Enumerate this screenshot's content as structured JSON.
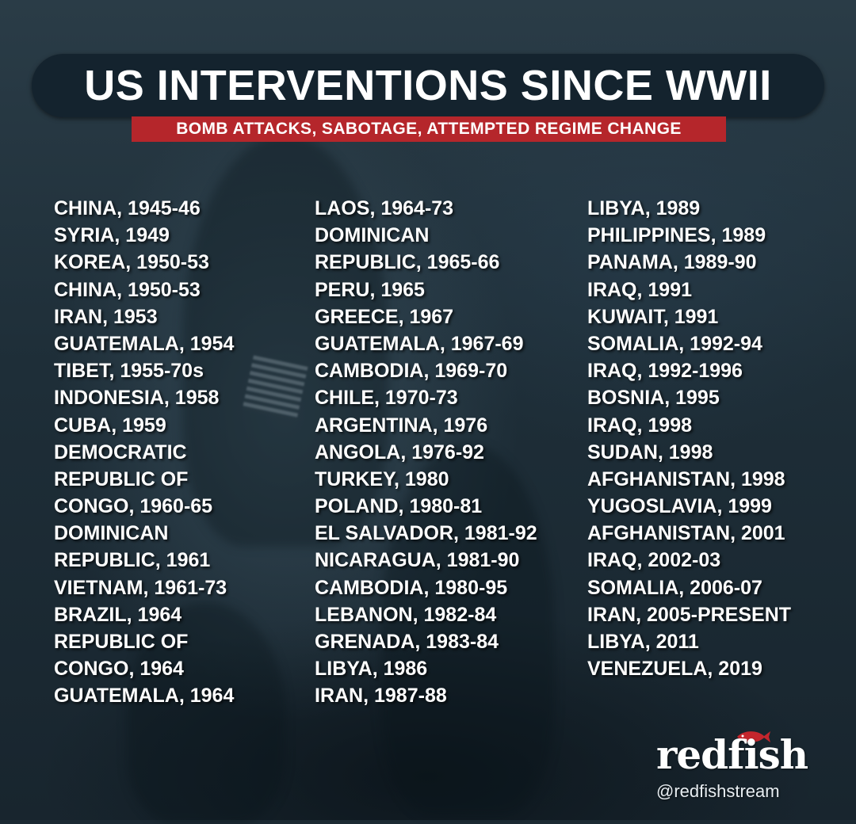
{
  "title": "US INTERVENTIONS SINCE WWII",
  "subtitle": "BOMB ATTACKS, SABOTAGE, ATTEMPTED REGIME CHANGE",
  "columns": [
    [
      "CHINA, 1945-46",
      "SYRIA, 1949",
      "KOREA, 1950-53",
      "CHINA, 1950-53",
      "IRAN, 1953",
      "GUATEMALA, 1954",
      "TIBET, 1955-70s",
      "INDONESIA, 1958",
      "CUBA, 1959",
      "DEMOCRATIC",
      "REPUBLIC OF",
      "CONGO, 1960-65",
      "DOMINICAN",
      "REPUBLIC, 1961",
      "VIETNAM, 1961-73",
      "BRAZIL, 1964",
      "REPUBLIC OF",
      "CONGO, 1964",
      "GUATEMALA, 1964"
    ],
    [
      "LAOS, 1964-73",
      "DOMINICAN",
      "REPUBLIC, 1965-66",
      "PERU, 1965",
      "GREECE, 1967",
      "GUATEMALA, 1967-69",
      "CAMBODIA, 1969-70",
      "CHILE, 1970-73",
      "ARGENTINA, 1976",
      "ANGOLA, 1976-92",
      "TURKEY, 1980",
      "POLAND, 1980-81",
      "EL SALVADOR, 1981-92",
      "NICARAGUA, 1981-90",
      "CAMBODIA, 1980-95",
      "LEBANON, 1982-84",
      "GRENADA, 1983-84",
      "LIBYA, 1986",
      "IRAN, 1987-88"
    ],
    [
      "LIBYA, 1989",
      "PHILIPPINES, 1989",
      "PANAMA, 1989-90",
      "IRAQ, 1991",
      "KUWAIT, 1991",
      "SOMALIA, 1992-94",
      "IRAQ, 1992-1996",
      "BOSNIA, 1995",
      "IRAQ, 1998",
      "SUDAN, 1998",
      "AFGHANISTAN, 1998",
      "YUGOSLAVIA, 1999",
      "AFGHANISTAN, 2001",
      "IRAQ, 2002-03",
      "SOMALIA, 2006-07",
      "IRAN, 2005-PRESENT",
      "LIBYA, 2011",
      "VENEZUELA, 2019"
    ]
  ],
  "logo": {
    "wordmark": "redfish",
    "handle": "@redfishstream",
    "icon": "fish-icon"
  },
  "colors": {
    "title_bar": "#14232e",
    "subtitle_bar": "#b5262b",
    "text": "#ffffff",
    "background": "#1f2f39",
    "fish": "#c4262d"
  }
}
